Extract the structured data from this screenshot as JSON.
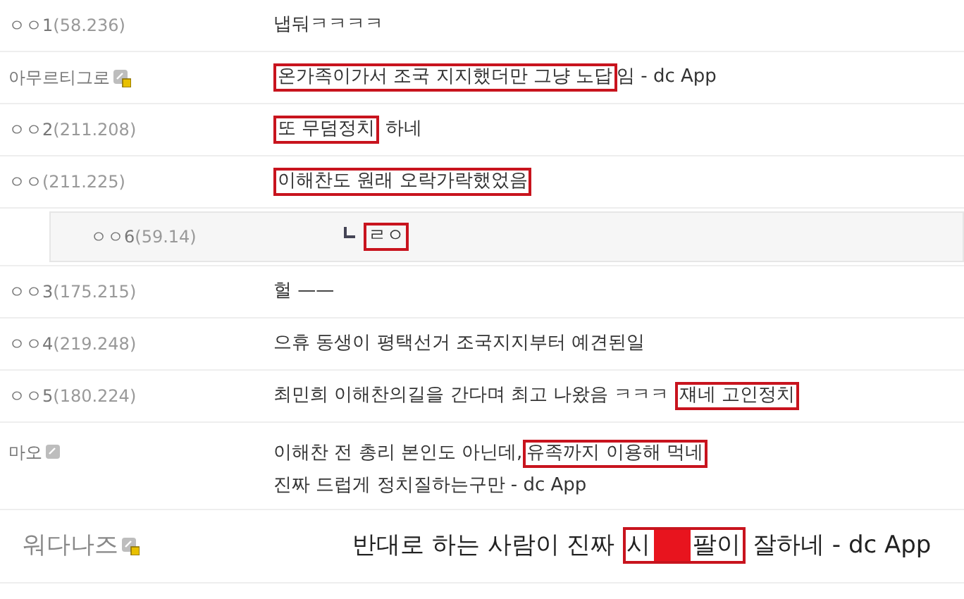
{
  "comments": [
    {
      "kind": "comment",
      "author": {
        "name": "ㅇㅇ1",
        "ip": "(58.236)"
      },
      "lines": [
        [
          {
            "kind": "text",
            "text": "냅둬ㅋㅋㅋㅋ"
          }
        ]
      ]
    },
    {
      "kind": "comment",
      "author": {
        "name": "아무르티그로",
        "nick_icon": true,
        "locked": true
      },
      "lines": [
        [
          {
            "kind": "boxed",
            "parts": [
              {
                "kind": "text",
                "text": "온가족이가서 조국 지지했더만 그냥 노답"
              }
            ]
          },
          {
            "kind": "text",
            "text": "임 - dc App"
          }
        ]
      ]
    },
    {
      "kind": "comment",
      "author": {
        "name": "ㅇㅇ2",
        "ip": "(211.208)"
      },
      "lines": [
        [
          {
            "kind": "boxed",
            "parts": [
              {
                "kind": "text",
                "text": "또 무덤정치"
              }
            ]
          },
          {
            "kind": "text",
            "text": " 하네"
          }
        ]
      ]
    },
    {
      "kind": "comment",
      "author": {
        "name": "ㅇㅇ",
        "ip": "(211.225)"
      },
      "lines": [
        [
          {
            "kind": "boxed",
            "parts": [
              {
                "kind": "text",
                "text": "이해찬도 원래 오락가락했었음"
              }
            ]
          }
        ]
      ]
    },
    {
      "kind": "reply",
      "author": {
        "name": "ㅇㅇ6",
        "ip": "(59.14)"
      },
      "lines": [
        [
          {
            "kind": "boxed",
            "parts": [
              {
                "kind": "text",
                "text": "ㄹㅇ"
              }
            ]
          }
        ]
      ]
    },
    {
      "kind": "comment",
      "author": {
        "name": "ㅇㅇ3",
        "ip": "(175.215)"
      },
      "lines": [
        [
          {
            "kind": "text",
            "text": "헐 ——"
          }
        ]
      ]
    },
    {
      "kind": "comment",
      "author": {
        "name": "ㅇㅇ4",
        "ip": "(219.248)"
      },
      "lines": [
        [
          {
            "kind": "text",
            "text": "으휴 동생이 평택선거 조국지지부터 예견된일"
          }
        ]
      ]
    },
    {
      "kind": "comment",
      "author": {
        "name": "ㅇㅇ5",
        "ip": "(180.224)"
      },
      "lines": [
        [
          {
            "kind": "text",
            "text": "최민희 이해찬의길을 간다며 최고 나왔음 ㅋㅋㅋ "
          },
          {
            "kind": "boxed",
            "parts": [
              {
                "kind": "text",
                "text": "쟤네 고인정치"
              }
            ]
          }
        ]
      ]
    },
    {
      "kind": "comment",
      "author": {
        "name": "마오",
        "nick_icon": true,
        "locked": false
      },
      "lines": [
        [
          {
            "kind": "text",
            "text": "이해찬 전 총리 본인도 아닌데,"
          },
          {
            "kind": "boxed",
            "parts": [
              {
                "kind": "text",
                "text": "유족까지 이용해 먹네"
              }
            ]
          }
        ],
        [
          {
            "kind": "text",
            "text": "진짜 드럽게 정치질하는구만 - dc App"
          }
        ]
      ]
    },
    {
      "kind": "large",
      "author": {
        "name": "워다나즈",
        "nick_icon": true,
        "locked": true
      },
      "lines": [
        [
          {
            "kind": "text",
            "text": "반대로 하는 사람이 진짜 "
          },
          {
            "kind": "boxed",
            "parts": [
              {
                "kind": "text",
                "text": "시"
              },
              {
                "kind": "censor"
              },
              {
                "kind": "text",
                "text": "팔이"
              }
            ]
          },
          {
            "kind": "text",
            "text": " 잘하네 - dc App"
          }
        ]
      ]
    }
  ]
}
